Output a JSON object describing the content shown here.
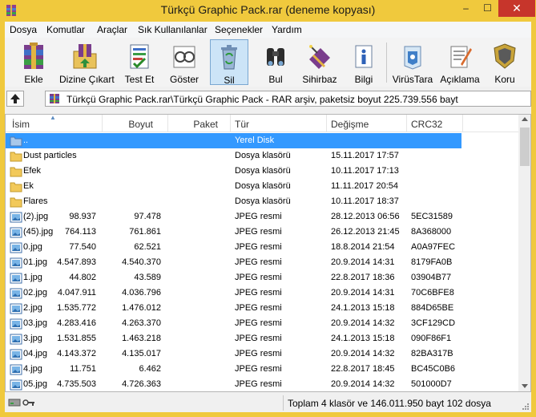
{
  "window": {
    "title": "Türkçü Graphic Pack.rar (deneme kopyası)",
    "minimize_glyph": "–",
    "maximize_glyph": "☐",
    "close_glyph": "✕"
  },
  "menu": {
    "items": [
      "Dosya",
      "Komutlar",
      "Araçlar",
      "Sık Kullanılanlar",
      "Seçenekler",
      "Yardım"
    ]
  },
  "toolbar": {
    "tools": [
      {
        "label": "Ekle",
        "icon": "add-archive-icon"
      },
      {
        "label": "Dizine Çıkart",
        "icon": "extract-to-folder-icon"
      },
      {
        "label": "Test Et",
        "icon": "test-archive-icon"
      },
      {
        "label": "Göster",
        "icon": "view-icon"
      },
      {
        "label": "Sil",
        "icon": "delete-icon"
      },
      {
        "label": "Bul",
        "icon": "find-icon"
      },
      {
        "label": "Sihirbaz",
        "icon": "wizard-icon"
      },
      {
        "label": "Bilgi",
        "icon": "info-icon"
      },
      {
        "label": "VirüsTara",
        "icon": "virus-scan-icon"
      },
      {
        "label": "Açıklama",
        "icon": "comment-icon"
      },
      {
        "label": "Koru",
        "icon": "protect-icon"
      }
    ]
  },
  "address": {
    "path": "Türkçü Graphic Pack.rar\\Türkçü Graphic Pack - RAR arşiv, paketsiz boyut 225.739.556 bayt"
  },
  "columns": {
    "name": "İsim",
    "size": "Boyut",
    "packed": "Paket",
    "type": "Tür",
    "modified": "Değişme",
    "crc": "CRC32"
  },
  "files": [
    {
      "name": "..",
      "size": "",
      "packed": "",
      "type": "Yerel Disk",
      "modified": "",
      "crc": "",
      "kind": "parent",
      "selected": true
    },
    {
      "name": "Dust particles",
      "size": "",
      "packed": "",
      "type": "Dosya klasörü",
      "modified": "15.11.2017 17:57",
      "crc": "",
      "kind": "folder"
    },
    {
      "name": "Efek",
      "size": "",
      "packed": "",
      "type": "Dosya klasörü",
      "modified": "10.11.2017 17:13",
      "crc": "",
      "kind": "folder"
    },
    {
      "name": "Ek",
      "size": "",
      "packed": "",
      "type": "Dosya klasörü",
      "modified": "11.11.2017 20:54",
      "crc": "",
      "kind": "folder"
    },
    {
      "name": "Flares",
      "size": "",
      "packed": "",
      "type": "Dosya klasörü",
      "modified": "10.11.2017 18:37",
      "crc": "",
      "kind": "folder"
    },
    {
      "name": "(2).jpg",
      "size": "98.937",
      "packed": "97.478",
      "type": "JPEG resmi",
      "modified": "28.12.2013 06:56",
      "crc": "5EC31589",
      "kind": "image"
    },
    {
      "name": "(45).jpg",
      "size": "764.113",
      "packed": "761.861",
      "type": "JPEG resmi",
      "modified": "26.12.2013 21:45",
      "crc": "8A368000",
      "kind": "image"
    },
    {
      "name": "0.jpg",
      "size": "77.540",
      "packed": "62.521",
      "type": "JPEG resmi",
      "modified": "18.8.2014 21:54",
      "crc": "A0A97FEC",
      "kind": "image"
    },
    {
      "name": "01.jpg",
      "size": "4.547.893",
      "packed": "4.540.370",
      "type": "JPEG resmi",
      "modified": "20.9.2014 14:31",
      "crc": "8179FA0B",
      "kind": "image"
    },
    {
      "name": "1.jpg",
      "size": "44.802",
      "packed": "43.589",
      "type": "JPEG resmi",
      "modified": "22.8.2017 18:36",
      "crc": "03904B77",
      "kind": "image"
    },
    {
      "name": "02.jpg",
      "size": "4.047.911",
      "packed": "4.036.796",
      "type": "JPEG resmi",
      "modified": "20.9.2014 14:31",
      "crc": "70C6BFE8",
      "kind": "image"
    },
    {
      "name": "2.jpg",
      "size": "1.535.772",
      "packed": "1.476.012",
      "type": "JPEG resmi",
      "modified": "24.1.2013 15:18",
      "crc": "884D65BE",
      "kind": "image"
    },
    {
      "name": "03.jpg",
      "size": "4.283.416",
      "packed": "4.263.370",
      "type": "JPEG resmi",
      "modified": "20.9.2014 14:32",
      "crc": "3CF129CD",
      "kind": "image"
    },
    {
      "name": "3.jpg",
      "size": "1.531.855",
      "packed": "1.463.218",
      "type": "JPEG resmi",
      "modified": "24.1.2013 15:18",
      "crc": "090F86F1",
      "kind": "image"
    },
    {
      "name": "04.jpg",
      "size": "4.143.372",
      "packed": "4.135.017",
      "type": "JPEG resmi",
      "modified": "20.9.2014 14:32",
      "crc": "82BA317B",
      "kind": "image"
    },
    {
      "name": "4.jpg",
      "size": "11.751",
      "packed": "6.462",
      "type": "JPEG resmi",
      "modified": "22.8.2017 18:45",
      "crc": "BC45C0B6",
      "kind": "image"
    },
    {
      "name": "05.jpg",
      "size": "4.735.503",
      "packed": "4.726.363",
      "type": "JPEG resmi",
      "modified": "20.9.2014 14:32",
      "crc": "501000D7",
      "kind": "image"
    }
  ],
  "status": {
    "text": "Toplam 4 klasör ve 146.011.950 bayt 102 dosya"
  },
  "colors": {
    "titlebar": "#f0c93d",
    "selection": "#3399ff",
    "close": "#c7352b"
  }
}
